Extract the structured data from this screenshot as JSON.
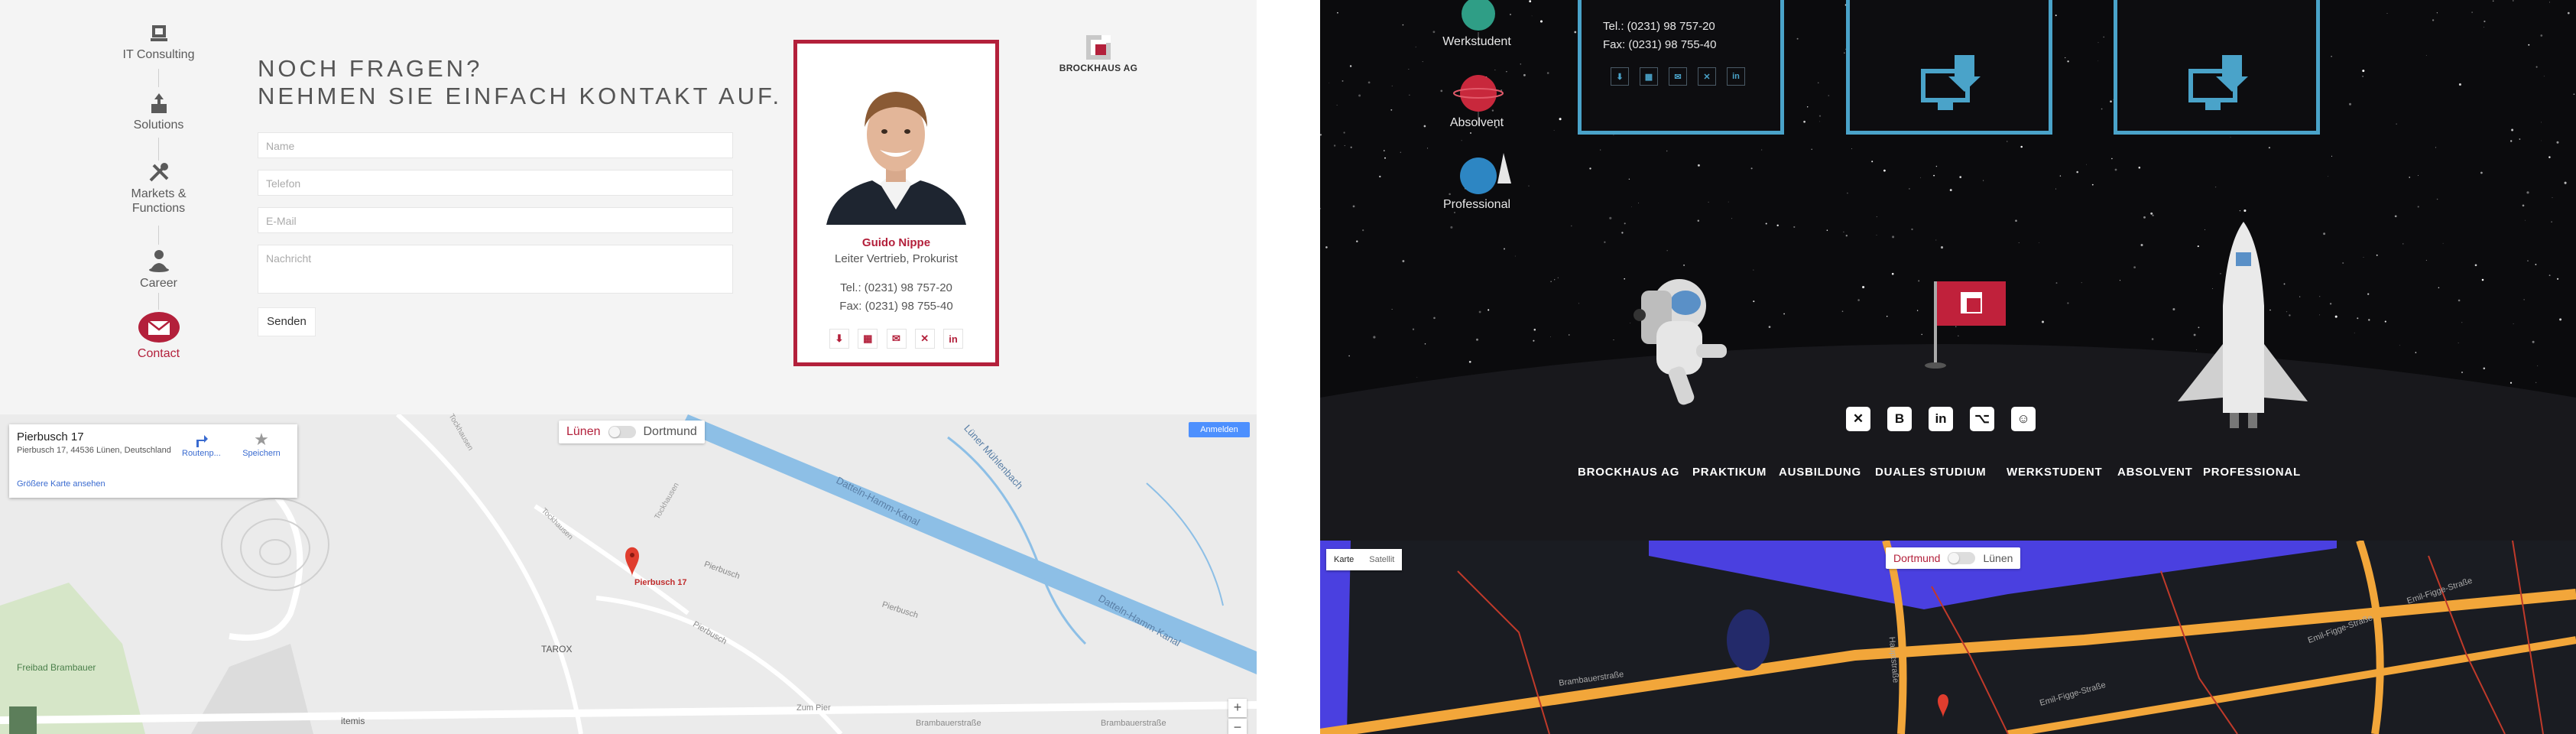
{
  "left": {
    "nav": [
      {
        "label": "IT Consulting",
        "icon": "monitor-icon"
      },
      {
        "label": "Solutions",
        "icon": "puzzle-icon"
      },
      {
        "label": "Markets & Functions",
        "icon": "tools-icon"
      },
      {
        "label": "Career",
        "icon": "person-icon"
      },
      {
        "label": "Contact",
        "icon": "mail-icon"
      }
    ],
    "title_line1": "NOCH FRAGEN?",
    "title_line2": "NEHMEN SIE EINFACH KONTAKT AUF.",
    "form": {
      "name_placeholder": "Name",
      "phone_placeholder": "Telefon",
      "email_placeholder": "E-Mail",
      "message_placeholder": "Nachricht",
      "send_label": "Senden"
    },
    "card": {
      "name": "Guido Nippe",
      "role": "Leiter Vertrieb, Prokurist",
      "tel": "Tel.: (0231) 98 757-20",
      "fax": "Fax: (0231) 98 755-40",
      "icons": [
        "vcard-icon",
        "qr-icon",
        "mail-icon",
        "xing-icon",
        "linkedin-icon"
      ]
    },
    "logo_text": "BROCKHAUS AG",
    "map": {
      "place_title": "Pierbusch 17",
      "address": "Pierbusch 17, 44536 Lünen, Deutschland",
      "larger_map": "Größere Karte ansehen",
      "route_label": "Routenp...",
      "save_label": "Speichern",
      "toggle_left": "Lünen",
      "toggle_right": "Dortmund",
      "signin": "Anmelden",
      "marker_label": "Pierbusch 17",
      "labels": {
        "canal1": "Datteln-Hamm-Kanal",
        "canal2": "Datteln-Hamm-Kanal",
        "muehlenbach": "Lüner Mühlenbach",
        "pierbusch": "Pierbusch",
        "pierbusch2": "Pierbusch",
        "pierbusch3": "Pierbusch",
        "tarox": "TAROX",
        "freibad": "Freibad Brambauer",
        "itemis": "itemis",
        "zumpier": "Zum Pier",
        "brambauer1": "Brambauerstraße",
        "brambauer2": "Brambauerstraße",
        "tockhausen": "Tockhausen",
        "tockhausen2": "Tockhausen",
        "tockhausen3": "Tockhausen"
      },
      "zoom_in": "+",
      "zoom_out": "−"
    }
  },
  "right": {
    "nav": [
      {
        "label": "Werkstudent"
      },
      {
        "label": "Absolvent"
      },
      {
        "label": "Professional"
      }
    ],
    "contact_tel": "Tel.: (0231) 98 757-20",
    "contact_fax": "Fax: (0231) 98 755-40",
    "contact_icons": [
      "vcard-icon",
      "qr-icon",
      "mail-icon",
      "xing-icon",
      "linkedin-icon"
    ],
    "social": [
      {
        "icon": "xing-icon",
        "glyph": "✕"
      },
      {
        "icon": "blogger-icon",
        "glyph": "B"
      },
      {
        "icon": "linkedin-icon",
        "glyph": "in"
      },
      {
        "icon": "github-icon",
        "glyph": "⌥"
      },
      {
        "icon": "kununu-icon",
        "glyph": "☺"
      }
    ],
    "footer_links": [
      "BROCKHAUS AG",
      "PRAKTIKUM",
      "AUSBILDUNG",
      "DUALES STUDIUM",
      "WERKSTUDENT",
      "ABSOLVENT",
      "PROFESSIONAL"
    ],
    "map": {
      "karte": "Karte",
      "satellit": "Satellit",
      "toggle_left": "Dortmund",
      "toggle_right": "Lünen",
      "road1": "Brambauerstraße",
      "road2": "Emil-Figge-Straße",
      "road3": "Emil-Figge-Straße",
      "road4": "Emil-Figge-Straße",
      "road5": "Hauptstraße"
    }
  },
  "colors": {
    "brand_red": "#b3203b",
    "space_blue": "#4aa3c9",
    "panel_bg": "#f4f4f4",
    "space_bg": "#0b0b0d"
  }
}
